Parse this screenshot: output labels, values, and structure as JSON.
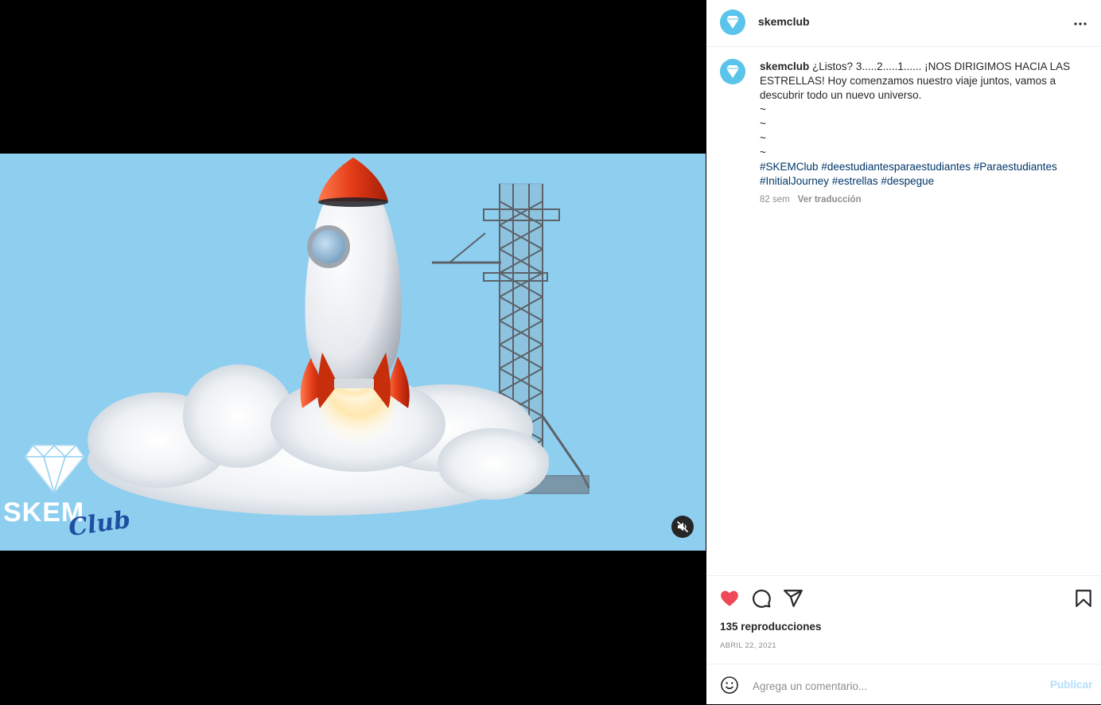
{
  "post": {
    "username": "skemclub",
    "avatar_icon": "diamond-logo-icon",
    "avatar_text": "SKEM",
    "caption_username": "skemclub",
    "caption_lines": [
      "¿Listos? 3.....2.....1...... ¡NOS DIRIGIMOS HACIA LAS",
      "ESTRELLAS! Hoy comenzamos nuestro viaje juntos, vamos a",
      "descubrir todo un nuevo universo.",
      "~",
      "~",
      "~",
      "~"
    ],
    "hashtags_line1": [
      "#SKEMClub",
      "#deestudiantesparaestudiantes",
      "#Paraestudiantes"
    ],
    "hashtags_line2": [
      "#InitialJourney",
      "#estrellas",
      "#despegue"
    ],
    "age": "82 sem",
    "translate_label": "Ver traducción",
    "views": "135 reproducciones",
    "date": "ABRIL 22, 2021"
  },
  "video": {
    "logo_text": "SKEM",
    "logo_script": "Club",
    "background_color": "#8ecff0",
    "muted_icon": "speaker-muted-icon"
  },
  "actions": {
    "like_icon": "heart-filled-icon",
    "like_color": "#ed4956",
    "comment_icon": "comment-icon",
    "share_icon": "paper-plane-icon",
    "save_icon": "bookmark-icon",
    "more_icon": "more-horizontal-icon"
  },
  "comment": {
    "placeholder": "Agrega un comentario...",
    "publish_label": "Publicar",
    "emoji_icon": "emoji-icon"
  }
}
